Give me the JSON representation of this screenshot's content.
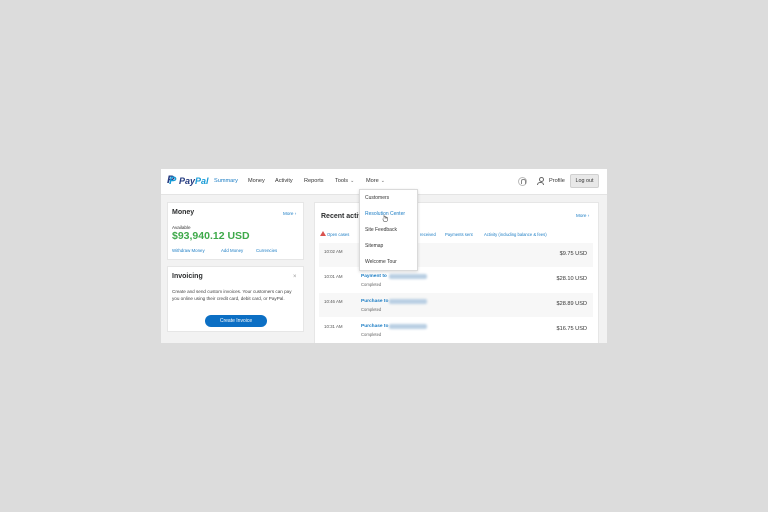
{
  "brand": {
    "pay": "Pay",
    "pal": "Pal",
    "mark": "P"
  },
  "nav": {
    "summary": "Summary",
    "money": "Money",
    "activity": "Activity",
    "reports": "Reports",
    "tools": "Tools",
    "more": "More"
  },
  "header": {
    "profile": "Profile",
    "logout": "Log out"
  },
  "money_card": {
    "title": "Money",
    "more": "More",
    "available_label": "Available",
    "balance": "$93,940.12 USD",
    "links": [
      "Withdraw Money",
      "Add Money",
      "Currencies"
    ]
  },
  "invoicing_card": {
    "title": "Invoicing",
    "close": "×",
    "text": "Create and send custom invoices. Your customers can pay you online using their credit card, debit card, or PayPal.",
    "button": "Create Invoice"
  },
  "activity": {
    "title": "Recent activity",
    "more": "More",
    "filters": [
      "Open cases",
      "received",
      "Payments sent",
      "Activity (including balance & fees)"
    ],
    "rows": [
      {
        "time": "10:02 AM",
        "name": "",
        "status": "",
        "amount": "$9.75 USD"
      },
      {
        "time": "10:01 AM",
        "name": "Payment to",
        "status": "Completed",
        "amount": "$28.10 USD"
      },
      {
        "time": "10:46 AM",
        "name": "Purchase to",
        "status": "Completed",
        "amount": "$28.89 USD"
      },
      {
        "time": "10:31 AM",
        "name": "Purchase to",
        "status": "Completed",
        "amount": "$16.75 USD"
      }
    ]
  },
  "more_menu": {
    "items": [
      "Customers",
      "Resolution Center",
      "Site Feedback",
      "Sitemap",
      "Welcome Tour"
    ],
    "hovered": "Resolution Center"
  },
  "colors": {
    "accent": "#1a7cc4",
    "balance_green": "#3ea94a",
    "brand_dark": "#253b80",
    "brand_light": "#179bd7",
    "page_bg": "#dcdcdc"
  }
}
